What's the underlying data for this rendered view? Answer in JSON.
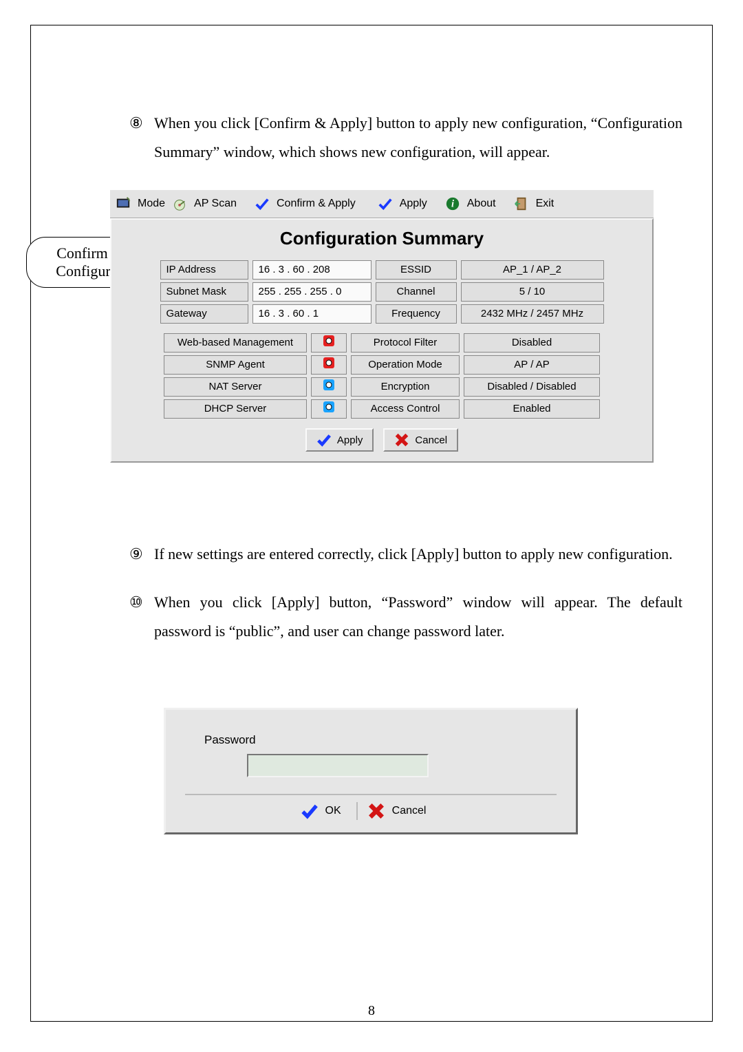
{
  "page_number": "8",
  "step8": {
    "num": "⑧",
    "text": "When you click [Confirm & Apply] button to apply new configuration, “Configuration Summary” window, which shows new configuration, will appear."
  },
  "callout": "Confirm New Configuration",
  "toolbar": {
    "mode": "Mode",
    "apscan": "AP Scan",
    "confirm": "Confirm & Apply",
    "apply": "Apply",
    "about": "About",
    "exit": "Exit"
  },
  "summary": {
    "title": "Configuration Summary",
    "left_labels": [
      "IP Address",
      "Subnet Mask",
      "Gateway"
    ],
    "left_values": [
      "16 .  3  . 60  . 208",
      "255 . 255 . 255 .  0",
      "16 .  3  . 60  .  1"
    ],
    "mid_labels": [
      "ESSID",
      "Channel",
      "Frequency"
    ],
    "mid_values": [
      "AP_1 / AP_2",
      "5 / 10",
      "2432 MHz / 2457 MHz"
    ],
    "svc_labels": [
      "Web-based Management",
      "SNMP Agent",
      "NAT Server",
      "DHCP Server"
    ],
    "svc_class": [
      "ic-red",
      "ic-red",
      "ic-cy",
      "ic-cy"
    ],
    "svc2_labels": [
      "Protocol Filter",
      "Operation Mode",
      "Encryption",
      "Access Control"
    ],
    "svc2_values": [
      "Disabled",
      "AP / AP",
      "Disabled / Disabled",
      "Enabled"
    ],
    "btn_apply": "Apply",
    "btn_cancel": "Cancel"
  },
  "step9": {
    "num": "⑨",
    "text": "If new settings are entered correctly, click [Apply] button to apply new configuration."
  },
  "step10": {
    "num": "⑩",
    "text": "When you click [Apply] button, “Password” window will appear. The default password is “public”, and user can change password later."
  },
  "password": {
    "label": "Password",
    "ok": "OK",
    "cancel": "Cancel"
  }
}
